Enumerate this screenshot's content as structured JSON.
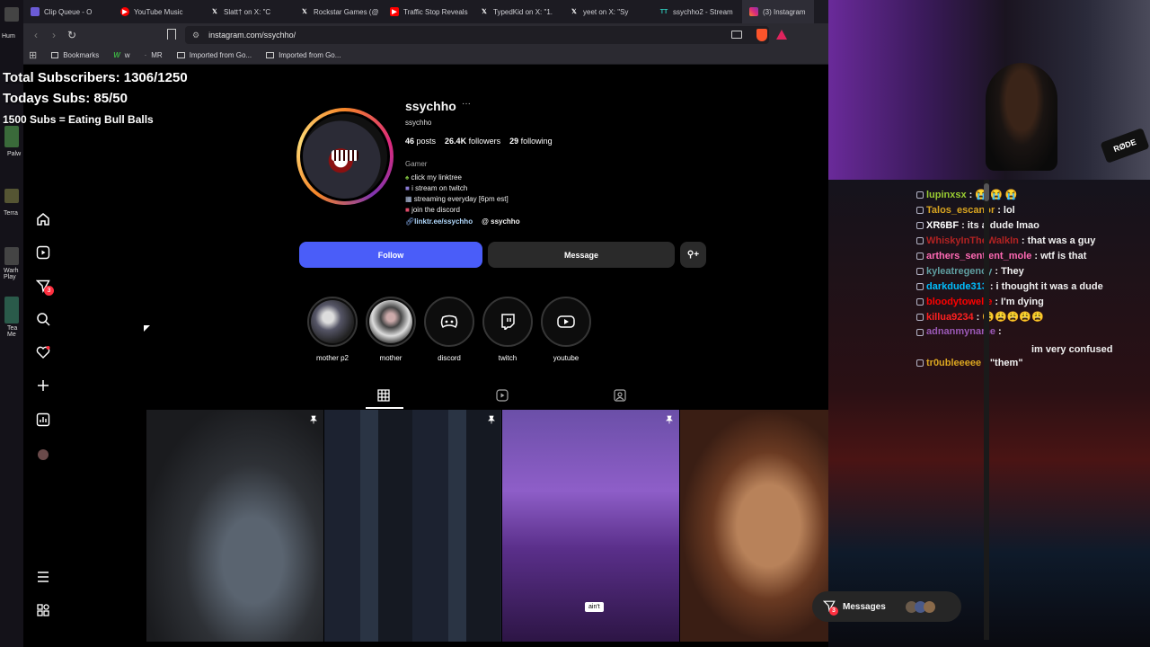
{
  "stream_overlay": {
    "total_subs": "Total Subscribers: 1306/1250",
    "today_subs": "Todays Subs: 85/50",
    "goal": "1500 Subs = Eating Bull Balls"
  },
  "browser": {
    "tabs": [
      {
        "label": "Clip Queue - O",
        "icon": "queue-icon",
        "color": "#6b5bd6"
      },
      {
        "label": "YouTube Music",
        "icon": "youtube-music-icon",
        "color": "#ff0000"
      },
      {
        "label": "Slatt† on X: \"C",
        "icon": "x-icon",
        "color": "#000000"
      },
      {
        "label": "Rockstar Games (@",
        "icon": "x-icon",
        "color": "#000000"
      },
      {
        "label": "Traffic Stop Reveals",
        "icon": "youtube-icon",
        "color": "#ff0000"
      },
      {
        "label": "TypedKid on X: \"1.",
        "icon": "x-icon",
        "color": "#000000"
      },
      {
        "label": "yeet on X: \"Sy",
        "icon": "x-icon",
        "color": "#000000"
      },
      {
        "label": "ssychho2 - Stream",
        "icon": "twitch-icon",
        "color": "#9146ff"
      },
      {
        "label": "(3) Instagram",
        "icon": "instagram-icon",
        "color": "#e1306c"
      }
    ],
    "url": "instagram.com/ssychho/",
    "bookmarks": [
      {
        "label": "Bookmarks"
      },
      {
        "label": "w"
      },
      {
        "label": "MR"
      },
      {
        "label": "Imported from Go..."
      },
      {
        "label": "Imported from Go..."
      }
    ]
  },
  "desktop_icons": [
    "Hum",
    "Palw",
    "Terra",
    "Warh Play",
    "Tea Me"
  ],
  "nav": {
    "notifications_badge": "3"
  },
  "profile": {
    "username": "ssychho",
    "display_name": "ssychho",
    "posts": "46",
    "posts_label": "posts",
    "followers": "26.4K",
    "followers_label": "followers",
    "following": "29",
    "following_label": "following",
    "category": "Gamer",
    "bio": [
      "click my linktree",
      "i stream on twitch",
      "streaming everyday [6pm est]",
      "join the discord"
    ],
    "link": "linktr.ee/ssychho",
    "threads": "ssychho",
    "follow_label": "Follow",
    "message_label": "Message"
  },
  "highlights": [
    {
      "label": "mother p2"
    },
    {
      "label": "mother"
    },
    {
      "label": "discord"
    },
    {
      "label": "twitch"
    },
    {
      "label": "youtube"
    }
  ],
  "posts": [
    {
      "caption": ""
    },
    {
      "caption": ""
    },
    {
      "caption": "ain't"
    },
    {
      "caption": ""
    }
  ],
  "messages_label": "Messages",
  "messages_badge": "3",
  "chat": [
    {
      "user": "lupinxsx",
      "msg": "😭 😭 😭",
      "color": "#9acd32"
    },
    {
      "user": "Talos_escanor",
      "msg": "lol",
      "color": "#daa520"
    },
    {
      "user": "XR6BF",
      "msg": "its a dude lmao",
      "color": "#ffffff"
    },
    {
      "user": "WhiskyInTheWalkIn",
      "msg": "that was a guy",
      "color": "#b22222"
    },
    {
      "user": "arthers_sentient_mole",
      "msg": "wtf is that",
      "color": "#ff69b4"
    },
    {
      "user": "kyleatregency",
      "msg": "They",
      "color": "#5f9ea0"
    },
    {
      "user": "darkdude313",
      "msg": "i thought it was a dude",
      "color": "#00bfff"
    },
    {
      "user": "bloodytowelie",
      "msg": "I'm dying",
      "color": "#ff0000"
    },
    {
      "user": "killua9234",
      "msg": "😩😩😩😩😩",
      "color": "#ff2020"
    },
    {
      "user": "adnanmyname",
      "msg": "im very confused",
      "color": "#9b59b6"
    },
    {
      "user": "tr0ubleeeee",
      "msg": "\"them\"",
      "color": "#daa520"
    }
  ]
}
